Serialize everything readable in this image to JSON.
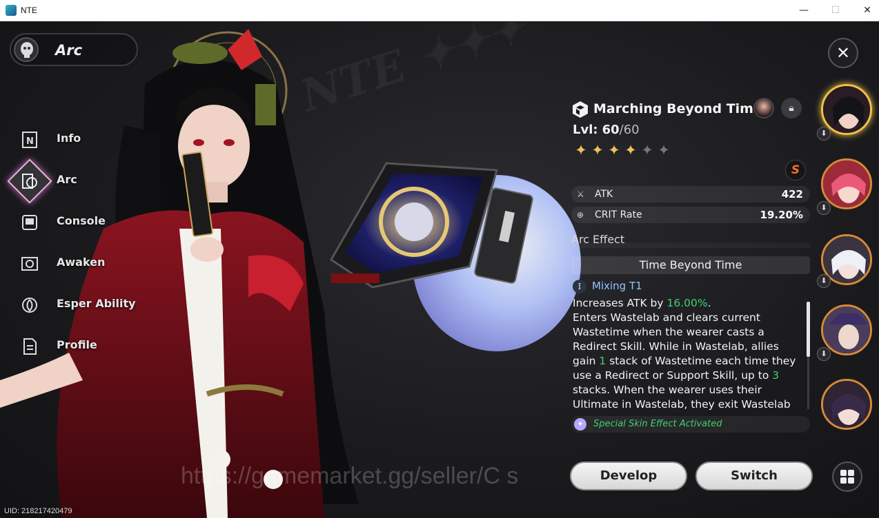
{
  "window": {
    "title": "NTE",
    "min": "—",
    "max": "☐",
    "close": "✕"
  },
  "profile": {
    "name": "Arc"
  },
  "nav": [
    {
      "label": "Info"
    },
    {
      "label": "Arc"
    },
    {
      "label": "Console"
    },
    {
      "label": "Awaken"
    },
    {
      "label": "Esper Ability"
    },
    {
      "label": "Profile"
    }
  ],
  "close_glyph": "✕",
  "arc": {
    "name": "Marching Beyond Time",
    "lvl_label": "Lvl:",
    "lvl_current": "60",
    "lvl_max": "/60",
    "stars_filled": 4,
    "stars_total": 6,
    "rank": "S",
    "stats": [
      {
        "name": "ATK",
        "value": "422",
        "icon": "atk-icon"
      },
      {
        "name": "CRIT Rate",
        "value": "19.20%",
        "icon": "crit-icon"
      }
    ],
    "effect_header": "Arc Effect",
    "effect_name": "Time Beyond Time",
    "mixing": {
      "numeral": "I",
      "label": "Mixing T1"
    },
    "skin_effect": "Special Skin Effect Activated"
  },
  "buttons": {
    "develop": "Develop",
    "switch": "Switch"
  },
  "watermark": "https://gamemarket.gg/seller/C                  s",
  "uid": "UID: 218217420479",
  "colors": {
    "accent_green": "#3fd36c",
    "gold": "#f3c057",
    "rank": "#ff6a2a"
  }
}
